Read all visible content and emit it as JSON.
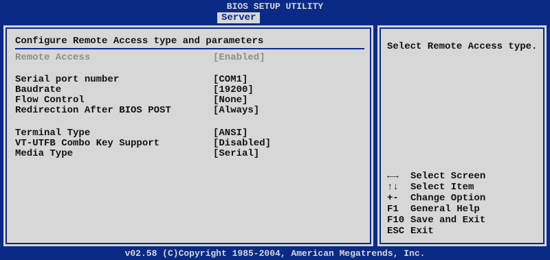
{
  "header": {
    "title": "BIOS SETUP UTILITY",
    "active_tab": "Server"
  },
  "main": {
    "section_title": "Configure Remote Access type and parameters",
    "items": [
      {
        "label": "Remote Access",
        "value": "[Enabled]",
        "disabled": true
      },
      {
        "label": "Serial port number",
        "value": "[COM1]"
      },
      {
        "label": "Baudrate",
        "value": "[19200]"
      },
      {
        "label": "Flow Control",
        "value": "[None]"
      },
      {
        "label": "Redirection After BIOS POST",
        "value": "[Always]"
      },
      {
        "label": "Terminal Type",
        "value": "[ANSI]"
      },
      {
        "label": "VT-UTFB Combo Key Support",
        "value": "[Disabled]"
      },
      {
        "label": "Media Type",
        "value": "[Serial]"
      }
    ]
  },
  "help": {
    "text": "Select Remote Access type."
  },
  "keys": [
    {
      "key": "←→",
      "action": "Select Screen"
    },
    {
      "key": "↑↓",
      "action": "Select Item"
    },
    {
      "key": "+-",
      "action": "Change Option"
    },
    {
      "key": "F1",
      "action": "General Help"
    },
    {
      "key": "F10",
      "action": "Save and Exit"
    },
    {
      "key": "ESC",
      "action": "Exit"
    }
  ],
  "footer": {
    "copyright": "v02.58 (C)Copyright 1985-2004, American Megatrends, Inc."
  }
}
